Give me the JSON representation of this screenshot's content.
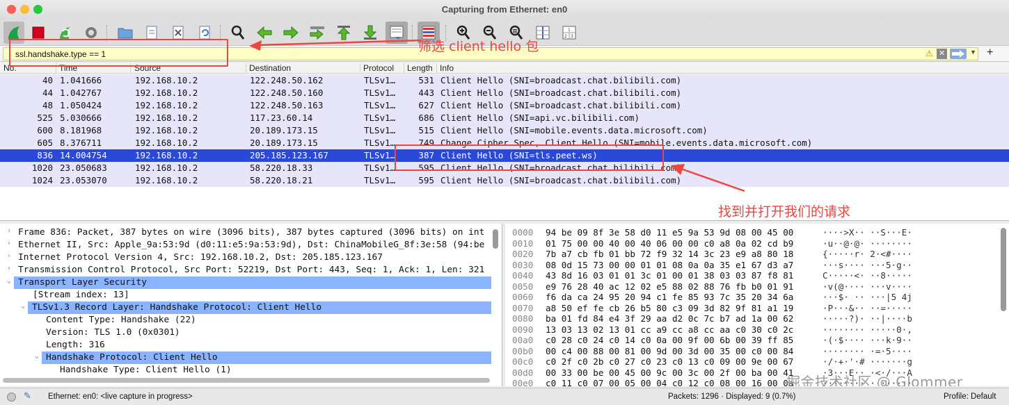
{
  "window": {
    "title": "Capturing from Ethernet: en0"
  },
  "toolbar": {
    "icons": [
      "shark-fin-start-icon",
      "stop-icon",
      "restart-capture-icon",
      "capture-options-gear-icon",
      "open-folder-icon",
      "save-file-icon",
      "close-file-icon",
      "reload-icon",
      "find-packet-icon",
      "go-back-arrow-icon",
      "go-forward-arrow-icon",
      "go-to-packet-icon",
      "first-packet-icon",
      "last-packet-icon",
      "autoscroll-icon",
      "colorize-icon",
      "zoom-in-icon",
      "zoom-out-icon",
      "normal-size-icon",
      "resize-columns-icon",
      "layout-icon"
    ]
  },
  "filter": {
    "value": "ssl.handshake.type == 1"
  },
  "columns": [
    "No.",
    "Time",
    "Source",
    "Destination",
    "Protocol",
    "Length",
    "Info"
  ],
  "packets": [
    {
      "no": "40",
      "time": "1.041666",
      "src": "192.168.10.2",
      "dst": "122.248.50.162",
      "proto": "TLSv1…",
      "len": "531",
      "info": "Client Hello (SNI=broadcast.chat.bilibili.com)"
    },
    {
      "no": "44",
      "time": "1.042767",
      "src": "192.168.10.2",
      "dst": "122.248.50.160",
      "proto": "TLSv1…",
      "len": "443",
      "info": "Client Hello (SNI=broadcast.chat.bilibili.com)"
    },
    {
      "no": "48",
      "time": "1.050424",
      "src": "192.168.10.2",
      "dst": "122.248.50.163",
      "proto": "TLSv1…",
      "len": "627",
      "info": "Client Hello (SNI=broadcast.chat.bilibili.com)"
    },
    {
      "no": "525",
      "time": "5.030666",
      "src": "192.168.10.2",
      "dst": "117.23.60.14",
      "proto": "TLSv1…",
      "len": "686",
      "info": "Client Hello (SNI=api.vc.bilibili.com)"
    },
    {
      "no": "600",
      "time": "8.181968",
      "src": "192.168.10.2",
      "dst": "20.189.173.15",
      "proto": "TLSv1…",
      "len": "515",
      "info": "Client Hello (SNI=mobile.events.data.microsoft.com)"
    },
    {
      "no": "605",
      "time": "8.376711",
      "src": "192.168.10.2",
      "dst": "20.189.173.15",
      "proto": "TLSv1…",
      "len": "749",
      "info": "Change Cipher Spec, Client Hello (SNI=mobile.events.data.microsoft.com)"
    },
    {
      "no": "836",
      "time": "14.004754",
      "src": "192.168.10.2",
      "dst": "205.185.123.167",
      "proto": "TLSv1…",
      "len": "387",
      "info": "Client Hello (SNI=tls.peet.ws)"
    },
    {
      "no": "1020",
      "time": "23.050683",
      "src": "192.168.10.2",
      "dst": "58.220.18.33",
      "proto": "TLSv1…",
      "len": "595",
      "info": "Client Hello (SNI=broadcast.chat.bilibili.com)"
    },
    {
      "no": "1024",
      "time": "23.053070",
      "src": "192.168.10.2",
      "dst": "58.220.18.21",
      "proto": "TLSv1…",
      "len": "595",
      "info": "Client Hello (SNI=broadcast.chat.bilibili.com)"
    }
  ],
  "details": [
    {
      "text": "Frame 836: Packet, 387 bytes on wire (3096 bits), 387 bytes captured (3096 bits) on int",
      "twisty": "›"
    },
    {
      "text": "Ethernet II, Src: Apple_9a:53:9d (d0:11:e5:9a:53:9d), Dst: ChinaMobileG_8f:3e:58 (94:be",
      "twisty": "›"
    },
    {
      "text": "Internet Protocol Version 4, Src: 192.168.10.2, Dst: 205.185.123.167",
      "twisty": "›"
    },
    {
      "text": "Transmission Control Protocol, Src Port: 52219, Dst Port: 443, Seq: 1, Ack: 1, Len: 321",
      "twisty": "›"
    },
    {
      "text": "Transport Layer Security",
      "twisty": "⌄"
    },
    {
      "text": "[Stream index: 13]",
      "twisty": ""
    },
    {
      "text": "TLSv1.3 Record Layer: Handshake Protocol: Client Hello",
      "twisty": "⌄"
    },
    {
      "text": "Content Type: Handshake (22)",
      "twisty": ""
    },
    {
      "text": "Version: TLS 1.0 (0x0301)",
      "twisty": ""
    },
    {
      "text": "Length: 316",
      "twisty": ""
    },
    {
      "text": "Handshake Protocol: Client Hello",
      "twisty": "⌄"
    },
    {
      "text": "Handshake Type: Client Hello (1)",
      "twisty": ""
    }
  ],
  "bytes": [
    {
      "off": "0000",
      "hex": "94 be 09 8f 3e 58 d0 11  e5 9a 53 9d 08 00 45 00",
      "asc": "····>X·· ··S···E·"
    },
    {
      "off": "0010",
      "hex": "01 75 00 00 40 00 40 06  00 00 c0 a8 0a 02 cd b9",
      "asc": "·u··@·@· ········"
    },
    {
      "off": "0020",
      "hex": "7b a7 cb fb 01 bb 72 f9  32 14 3c 23 e9 a8 80 18",
      "asc": "{·····r· 2·<#····"
    },
    {
      "off": "0030",
      "hex": "08 0d 15 73 00 00 01 01  08 0a 0a 35 e1 67 d3 a7",
      "asc": "···s···· ···5·g··"
    },
    {
      "off": "0040",
      "hex": "43 8d 16 03 01 01 3c 01  00 01 38 03 03 87 f8 81",
      "asc": "C·····<· ··8·····"
    },
    {
      "off": "0050",
      "hex": "e9 76 28 40 ac 12 02 e5  88 02 88 76 fb b0 01 91",
      "asc": "·v(@···· ···v····"
    },
    {
      "off": "0060",
      "hex": "f6 da ca 24 95 20 94 c1  fe 85 93 7c 35 20 34 6a",
      "asc": "···$· ·· ···|5 4j"
    },
    {
      "off": "0070",
      "hex": "a8 50 ef fe cb 26 b5 80  c3 09 3d 82 9f 81 a1 19",
      "asc": "·P···&·· ··=·····"
    },
    {
      "off": "0080",
      "hex": "ba 01 fd 84 e4 3f 29 aa  d2 0c 7c b7 ad 1a 00 62",
      "asc": "·····?)· ··|····b"
    },
    {
      "off": "0090",
      "hex": "13 03 13 02 13 01 cc a9  cc a8 cc aa c0 30 c0 2c",
      "asc": "········ ·····0·,"
    },
    {
      "off": "00a0",
      "hex": "c0 28 c0 24 c0 14 c0 0a  00 9f 00 6b 00 39 ff 85",
      "asc": "·(·$···· ···k·9··"
    },
    {
      "off": "00b0",
      "hex": "00 c4 00 88 00 81 00 9d  00 3d 00 35 00 c0 00 84",
      "asc": "········ ·=·5····"
    },
    {
      "off": "00c0",
      "hex": "c0 2f c0 2b c0 27 c0 23  c0 13 c0 09 00 9e 00 67",
      "asc": "·/·+·'·# ·······g"
    },
    {
      "off": "00d0",
      "hex": "00 33 00 be 00 45 00 9c  00 3c 00 2f 00 ba 00 41",
      "asc": "·3···E·· ·<·/···A"
    },
    {
      "off": "00e0",
      "hex": "c0 11 c0 07 00 05 00 04  c0 12 c0 08 00 16 00 0a",
      "asc": "········ ········"
    }
  ],
  "status": {
    "capture": "Ethernet: en0: <live capture in progress>",
    "packets": "Packets: 1296 · Displayed: 9 (0.7%)",
    "profile": "Profile: Default"
  },
  "annotations": {
    "filter_note": "筛选 client hello 包",
    "request_note": "找到并打开我们的请求"
  },
  "watermark": "掘金技术社区 @ Glommer",
  "colors": {
    "selected_row": "#2b49d9",
    "row_bg": "#e6e5fa",
    "highlight": "#8ab4ff",
    "filter_bg": "#ffffc6",
    "annotation": "#f0453f"
  }
}
